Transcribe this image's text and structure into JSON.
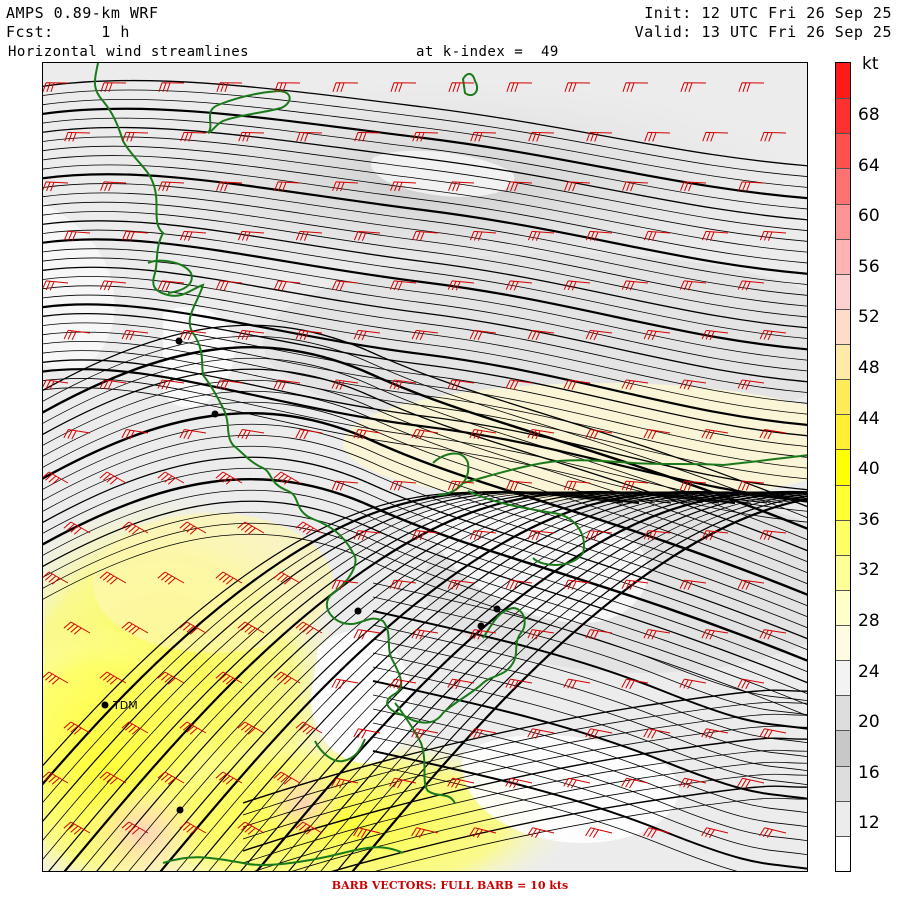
{
  "header": {
    "model": "AMPS 0.89-km WRF",
    "fcst": "Fcst:     1 h",
    "product": "Horizontal wind streamlines",
    "level": "at k-index =  49",
    "init": "Init: 12 UTC Fri 26 Sep 25",
    "valid": "Valid: 13 UTC Fri 26 Sep 25"
  },
  "colorbar": {
    "unit": "kt",
    "labels": [
      "68",
      "64",
      "60",
      "56",
      "52",
      "48",
      "44",
      "40",
      "36",
      "32",
      "28",
      "24",
      "20",
      "16",
      "12"
    ],
    "colors": [
      "#ff1a1a",
      "#ff3030",
      "#ff5050",
      "#ff7272",
      "#ff9494",
      "#ffb4b4",
      "#ffd0d0",
      "#ffdcc8",
      "#ffe9a8",
      "#ffea5a",
      "#ffee33",
      "#ffff00",
      "#ffff33",
      "#ffff66",
      "#ffff99",
      "#ffffc8",
      "#fffbe0",
      "#f3f3f3",
      "#dddddd",
      "#c8c8c8",
      "#dddddd",
      "#ececec",
      "#ffffff"
    ]
  },
  "stations": [
    {
      "label": "TDM"
    }
  ],
  "footer": "BARB VECTORS:  FULL BARB = 10 kts",
  "legend_colors": {
    "barb": "#d40000",
    "coast": "#1a7a1a",
    "streamline": "#000000"
  }
}
